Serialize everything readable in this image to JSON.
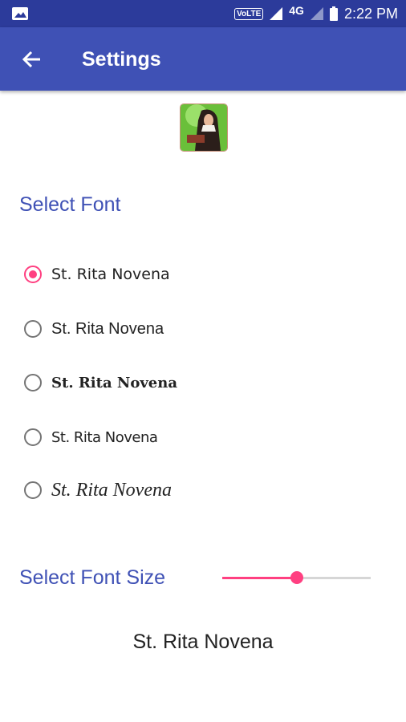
{
  "status_bar": {
    "volte": "VoLTE",
    "network": "4G",
    "time": "2:22 PM"
  },
  "app_bar": {
    "title": "Settings"
  },
  "font_section": {
    "heading": "Select Font",
    "options": [
      {
        "label": "St. Rita Novena",
        "selected": true
      },
      {
        "label": "St. Rita Novena",
        "selected": false
      },
      {
        "label": "St. Rita Novena",
        "selected": false
      },
      {
        "label": "St. Rita Novena",
        "selected": false
      },
      {
        "label": "St. Rita Novena",
        "selected": false
      }
    ]
  },
  "font_size_section": {
    "heading": "Select Font Size",
    "slider_value": 0.5
  },
  "preview": {
    "text": "St. Rita Novena"
  },
  "colors": {
    "primary": "#3f51b5",
    "primary_dark": "#2c3b9b",
    "accent": "#ff4081"
  }
}
